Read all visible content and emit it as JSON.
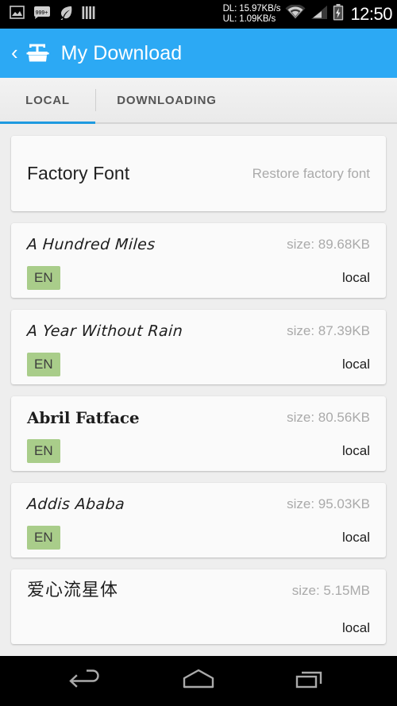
{
  "status_bar": {
    "icons": [
      {
        "name": "photo-icon"
      },
      {
        "name": "messages-icon",
        "badge": "999+"
      },
      {
        "name": "leaf-icon"
      },
      {
        "name": "bars-icon"
      }
    ],
    "download_speed": "DL: 15.97KB/s",
    "upload_speed": "UL: 1.09KB/s",
    "wifi_icon": "wifi-icon",
    "signal_icon": "signal-icon",
    "battery_icon": "battery-charging-icon",
    "clock": "12:50"
  },
  "action_bar": {
    "back_label": "‹",
    "app_icon": "font-manager-icon",
    "title": "My Download",
    "accent_color": "#2ca9f4"
  },
  "tabs": {
    "items": [
      {
        "label": "LOCAL",
        "active": true
      },
      {
        "label": "DOWNLOADING",
        "active": false
      }
    ],
    "indicator_color": "#1e9ae0"
  },
  "factory_card": {
    "title": "Factory Font",
    "action": "Restore factory font"
  },
  "font_list": [
    {
      "name": "A Hundred Miles",
      "style": "hand",
      "language": "EN",
      "size": "size: 89.68KB",
      "status": "local"
    },
    {
      "name": "A Year Without Rain",
      "style": "hand",
      "language": "EN",
      "size": "size: 87.39KB",
      "status": "local"
    },
    {
      "name": "Abril Fatface",
      "style": "didone",
      "language": "EN",
      "size": "size: 80.56KB",
      "status": "local"
    },
    {
      "name": "Addis Ababa",
      "style": "hand",
      "language": "EN",
      "size": "size: 95.03KB",
      "status": "local"
    },
    {
      "name": "爱心流星体",
      "style": "cjk",
      "language": "",
      "size": "size: 5.15MB",
      "status": "local"
    }
  ],
  "nav_bar": {
    "back": "back-icon",
    "home": "home-icon",
    "recents": "recents-icon"
  },
  "colors": {
    "badge_green": "#a9cd8a",
    "page_bg": "#eeeeee",
    "card_bg": "#fafafa"
  }
}
